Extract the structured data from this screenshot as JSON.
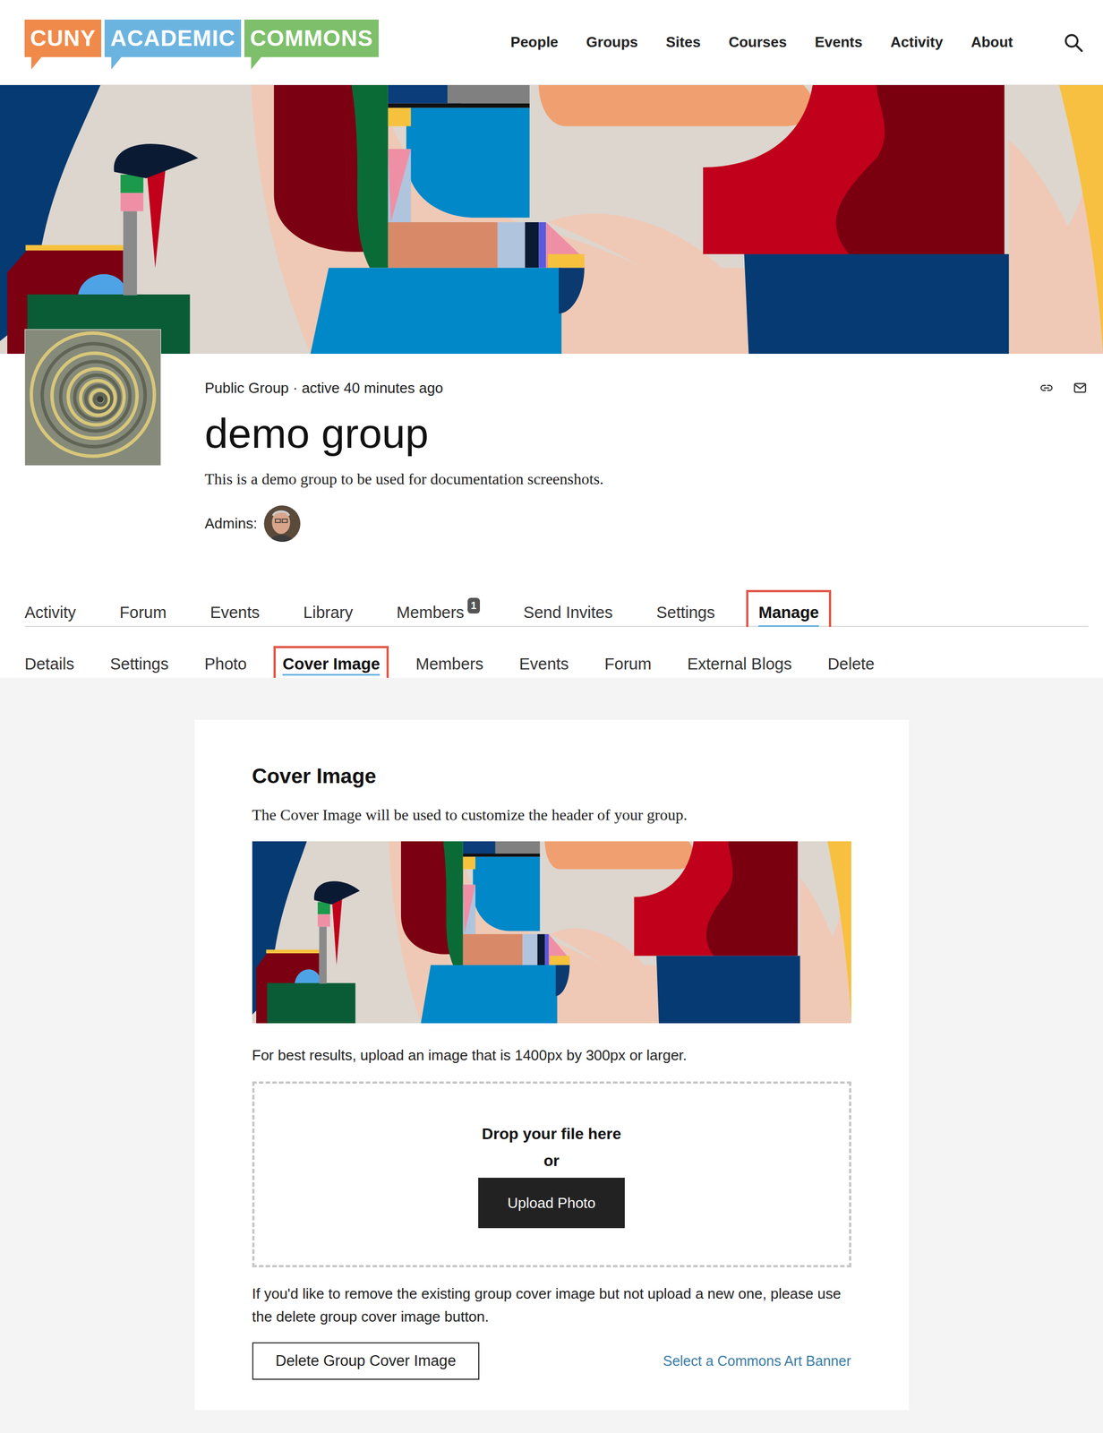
{
  "logo": {
    "parts": [
      "CUNY",
      "ACADEMIC",
      "COMMONS"
    ]
  },
  "nav": [
    "People",
    "Groups",
    "Sites",
    "Courses",
    "Events",
    "Activity",
    "About"
  ],
  "group": {
    "meta": "Public Group · active 40 minutes ago",
    "name": "demo group",
    "description": "This is a demo group to be used for documentation screenshots.",
    "admins_label": "Admins:"
  },
  "tabs": [
    {
      "label": "Activity",
      "selected": false,
      "highlighted": false
    },
    {
      "label": "Forum",
      "selected": false,
      "highlighted": false
    },
    {
      "label": "Events",
      "selected": false,
      "highlighted": false
    },
    {
      "label": "Library",
      "selected": false,
      "highlighted": false
    },
    {
      "label": "Members",
      "selected": false,
      "highlighted": false,
      "badge": "1"
    },
    {
      "label": "Send Invites",
      "selected": false,
      "highlighted": false
    },
    {
      "label": "Settings",
      "selected": false,
      "highlighted": false
    },
    {
      "label": "Manage",
      "selected": true,
      "highlighted": true
    }
  ],
  "subtabs": [
    {
      "label": "Details",
      "selected": false,
      "highlighted": false
    },
    {
      "label": "Settings",
      "selected": false,
      "highlighted": false
    },
    {
      "label": "Photo",
      "selected": false,
      "highlighted": false
    },
    {
      "label": "Cover Image",
      "selected": true,
      "highlighted": true
    },
    {
      "label": "Members",
      "selected": false,
      "highlighted": false
    },
    {
      "label": "Events",
      "selected": false,
      "highlighted": false
    },
    {
      "label": "Forum",
      "selected": false,
      "highlighted": false
    },
    {
      "label": "External Blogs",
      "selected": false,
      "highlighted": false
    },
    {
      "label": "Delete",
      "selected": false,
      "highlighted": false
    }
  ],
  "cover_panel": {
    "title": "Cover Image",
    "intro": "The Cover Image will be used to customize the header of your group.",
    "hint": "For best results, upload an image that is 1400px by 300px or larger.",
    "drop_text": "Drop your file here",
    "or_text": "or",
    "upload_button": "Upload Photo",
    "remove_note": "If you'd like to remove the existing group cover image but not upload a new one, please use the delete group cover image button.",
    "delete_button": "Delete Group Cover Image",
    "art_link": "Select a Commons Art Banner"
  }
}
